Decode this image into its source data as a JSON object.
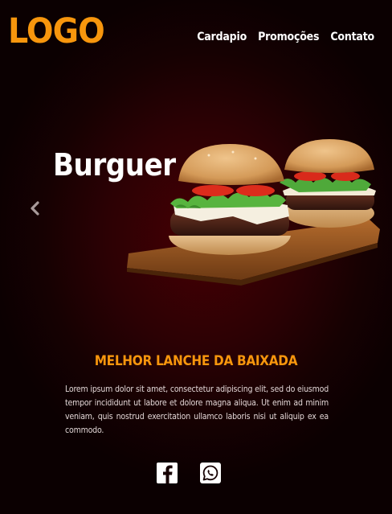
{
  "header": {
    "logo": "LOGO",
    "nav": [
      {
        "label": "Cardapio"
      },
      {
        "label": "Promoções"
      },
      {
        "label": "Contato"
      }
    ]
  },
  "hero": {
    "title": "Burguer"
  },
  "section": {
    "title": "MELHOR LANCHE DA BAIXADA",
    "text": "Lorem ipsum dolor sit amet, consectetur adipiscing elit, sed do eiusmod tempor incididunt ut labore et dolore magna aliqua. Ut enim ad minim veniam, quis nostrud exercitation ullamco laboris nisi ut aliquip ex ea commodo."
  },
  "icons": {
    "prev": "chevron-left-icon",
    "social": [
      "facebook-icon",
      "whatsapp-icon"
    ]
  },
  "colors": {
    "accent": "#f7960d",
    "background": "#2c0104"
  }
}
